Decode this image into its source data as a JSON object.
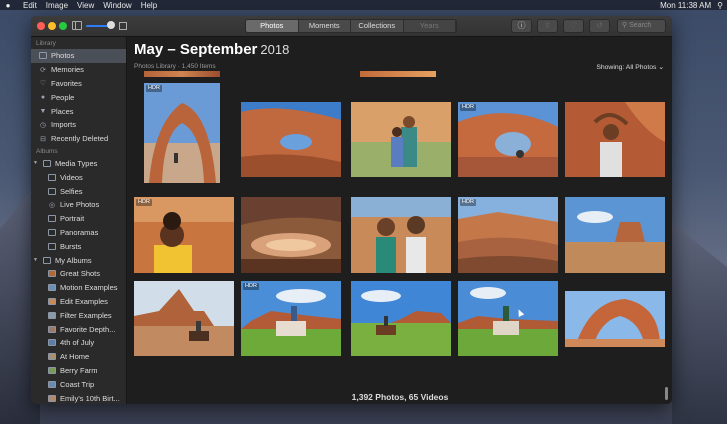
{
  "menubar": {
    "apple": "",
    "items": [
      "Edit",
      "Image",
      "View",
      "Window",
      "Help"
    ],
    "clock": "Mon 11:38 AM"
  },
  "toolbar": {
    "segments": [
      "Photos",
      "Moments",
      "Collections",
      "Years"
    ],
    "search_placeholder": "Search"
  },
  "sidebar": {
    "library_header": "Library",
    "library_items": [
      {
        "label": "Photos",
        "icon": "photos-icon"
      },
      {
        "label": "Memories",
        "icon": "memories-icon"
      },
      {
        "label": "Favorites",
        "icon": "heart-icon"
      },
      {
        "label": "People",
        "icon": "person-icon"
      },
      {
        "label": "Places",
        "icon": "pin-icon"
      },
      {
        "label": "Imports",
        "icon": "clock-icon"
      },
      {
        "label": "Recently Deleted",
        "icon": "trash-icon"
      }
    ],
    "albums_header": "Albums",
    "media_types_label": "Media Types",
    "media_types": [
      "Videos",
      "Selfies",
      "Live Photos",
      "Portrait",
      "Panoramas",
      "Bursts"
    ],
    "my_albums_label": "My Albums",
    "my_albums": [
      "Great Shots",
      "Motion Examples",
      "Edit Examples",
      "Filter Examples",
      "Favorite Depth...",
      "4th of July",
      "At Home",
      "Berry Farm",
      "Coast Trip",
      "Emily's 10th Birt..."
    ]
  },
  "main": {
    "title": "May – September",
    "year": "2018",
    "subtitle": "Photos Library · 1,450 Items",
    "showing_label": "Showing:",
    "showing_value": "All Photos",
    "footer": "1,392 Photos, 65 Videos",
    "hdr_badge": "HDR"
  }
}
